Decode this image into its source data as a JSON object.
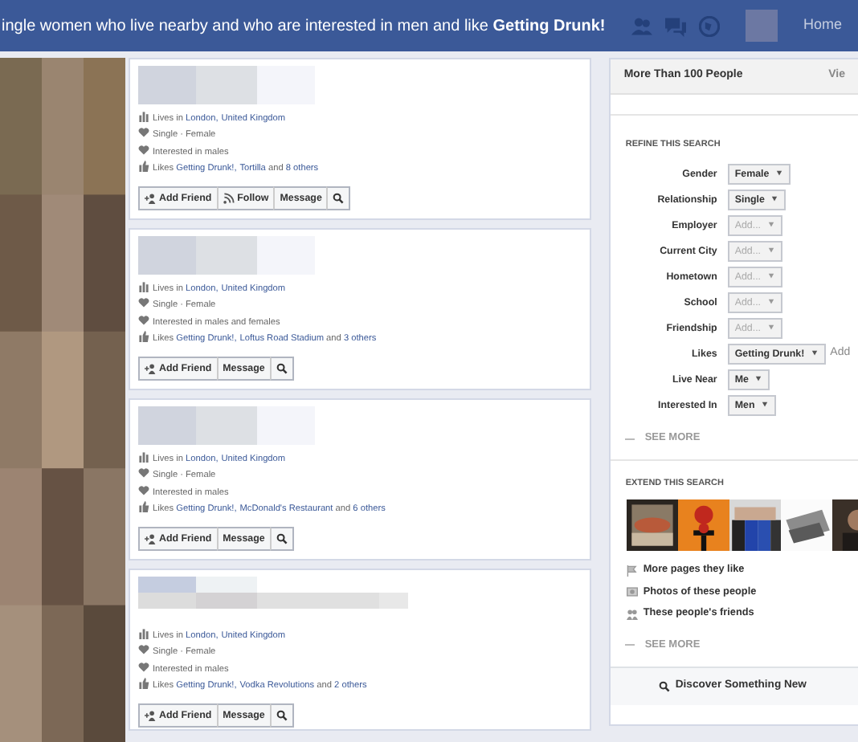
{
  "header": {
    "title": "ingle women who live nearby and who are interested in men and like **Getting Drunk!**",
    "home": "Home"
  },
  "results": [
    {
      "kind": "picture",
      "info": [
        [
          {
            "text": "Lives in ",
            "link": false
          },
          {
            "text": "London,",
            "link": true
          },
          {
            "text": "United Kingdom",
            "link": true
          }
        ],
        [
          {
            "text": "Single · Female",
            "link": false
          }
        ],
        [
          {
            "text": "Interested in males",
            "link": false
          }
        ],
        [
          {
            "text": "Likes ",
            "link": false
          },
          {
            "text": "Getting Drunk!,",
            "link": true
          },
          {
            "text": "Tortilla",
            "link": true
          },
          {
            "text": " and ",
            "link": false
          },
          {
            "text": "8 others",
            "link": true
          }
        ]
      ],
      "buttons": [
        {
          "kind": "add-friend",
          "label": "Add Friend"
        },
        {
          "kind": "follow",
          "label": "Follow"
        },
        {
          "kind": "message",
          "label": "Message"
        }
      ]
    },
    {
      "kind": "picture",
      "info": [
        [
          {
            "text": "Lives in ",
            "link": false
          },
          {
            "text": "London,",
            "link": true
          },
          {
            "text": "United Kingdom",
            "link": true
          }
        ],
        [
          {
            "text": "Single · Female",
            "link": false
          }
        ],
        [
          {
            "text": "Interested in males and females",
            "link": false
          }
        ],
        [
          {
            "text": "Likes ",
            "link": false
          },
          {
            "text": "Getting Drunk!,",
            "link": true
          },
          {
            "text": "Loftus Road Stadium",
            "link": true
          },
          {
            "text": " and ",
            "link": false
          },
          {
            "text": "3 others",
            "link": true
          }
        ]
      ],
      "buttons": [
        {
          "kind": "add-friend",
          "label": "Add Friend"
        },
        {
          "kind": "message",
          "label": "Message"
        }
      ]
    },
    {
      "kind": "picture",
      "info": [
        [
          {
            "text": "Lives in ",
            "link": false
          },
          {
            "text": "London,",
            "link": true
          },
          {
            "text": "United Kingdom",
            "link": true
          }
        ],
        [
          {
            "text": "Single · Female",
            "link": false
          }
        ],
        [
          {
            "text": "Interested in males",
            "link": false
          }
        ],
        [
          {
            "text": "Likes ",
            "link": false
          },
          {
            "text": "Getting Drunk!,",
            "link": true
          },
          {
            "text": "McDonald's Restaurant",
            "link": true
          },
          {
            "text": " and ",
            "link": false
          },
          {
            "text": "6 others",
            "link": true
          }
        ]
      ],
      "buttons": [
        {
          "kind": "add-friend",
          "label": "Add Friend"
        },
        {
          "kind": "message",
          "label": "Message"
        }
      ]
    },
    {
      "kind": "picture",
      "info": [
        [
          {
            "text": "Lives in ",
            "link": false
          },
          {
            "text": "London,",
            "link": true
          },
          {
            "text": "United Kingdom",
            "link": true
          }
        ],
        [
          {
            "text": "Single · Female",
            "link": false
          }
        ],
        [
          {
            "text": "Interested in males",
            "link": false
          }
        ],
        [
          {
            "text": "Likes ",
            "link": false
          },
          {
            "text": "Getting Drunk!,",
            "link": true
          },
          {
            "text": "Vodka Revolutions",
            "link": true
          },
          {
            "text": " and ",
            "link": false
          },
          {
            "text": "2 others",
            "link": true
          }
        ]
      ],
      "buttons": [
        {
          "kind": "add-friend",
          "label": "Add Friend"
        },
        {
          "kind": "message",
          "label": "Message"
        }
      ]
    }
  ],
  "sidebar": {
    "title": "More Than 100 People",
    "view": "Vie",
    "refine_heading": "REFINE THIS SEARCH",
    "filters": [
      {
        "label": "Gender",
        "value": "Female",
        "empty": false
      },
      {
        "label": "Relationship",
        "value": "Single",
        "empty": false
      },
      {
        "label": "Employer",
        "value": "Add...",
        "empty": true
      },
      {
        "label": "Current City",
        "value": "Add...",
        "empty": true
      },
      {
        "label": "Hometown",
        "value": "Add...",
        "empty": true
      },
      {
        "label": "School",
        "value": "Add...",
        "empty": true
      },
      {
        "label": "Friendship",
        "value": "Add...",
        "empty": true
      },
      {
        "label": "Likes",
        "value": "Getting Drunk!",
        "empty": false,
        "extra": "Add"
      },
      {
        "label": "Live Near",
        "value": "Me",
        "empty": false
      },
      {
        "label": "Interested In",
        "value": "Men",
        "empty": false
      }
    ],
    "see_more_1": "SEE MORE",
    "extend_heading": "EXTEND THIS SEARCH",
    "links": [
      {
        "kind": "pages",
        "label": "More pages they like"
      },
      {
        "kind": "photos",
        "label": "Photos of these people"
      },
      {
        "kind": "friends",
        "label": "These people's friends"
      }
    ],
    "see_more_2": "SEE MORE",
    "footer_button": "Discover Something New"
  }
}
